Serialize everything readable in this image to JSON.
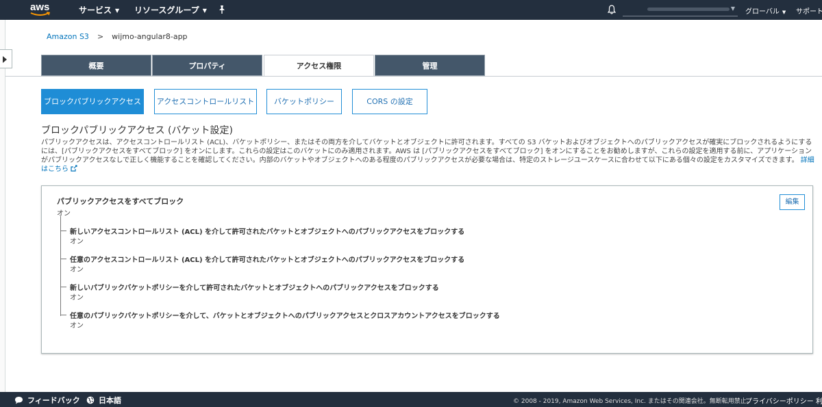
{
  "topnav": {
    "logo_text": "aws",
    "services_label": "サービス",
    "resource_groups_label": "リソースグループ",
    "region_label": "グローバル",
    "support_label": "サポート"
  },
  "breadcrumb": {
    "root": "Amazon S3",
    "separator": ">",
    "current": "wijmo-angular8-app"
  },
  "tabs": [
    "概要",
    "プロパティ",
    "アクセス権限",
    "管理"
  ],
  "subtabs": [
    "ブロックパブリックアクセス",
    "アクセスコントロールリスト",
    "バケットポリシー",
    "CORS の設定"
  ],
  "section": {
    "title": "ブロックパブリックアクセス (バケット設定)",
    "description": "パブリックアクセスは、アクセスコントロールリスト (ACL)、バケットポリシー、またはその両方を介してバケットとオブジェクトに許可されます。すべての S3 バケットおよびオブジェクトへのパブリックアクセスが確実にブロックされるようにするには、[パブリックアクセスをすべてブロック] をオンにします。これらの設定はこのバケットにのみ適用されます。AWS は [パブリックアクセスをすべてブロック] をオンにすることをお勧めしますが、これらの設定を適用する前に、アプリケーションがパブリックアクセスなしで正しく機能することを確認してください。内部のバケットやオブジェクトへのある程度のパブリックアクセスが必要な場合は、特定のストレージユースケースに合わせて以下にある個々の設定をカスタマイズできます。",
    "more_link": "詳細はこちら"
  },
  "settings": {
    "edit_label": "編集",
    "main": {
      "label": "パブリックアクセスをすべてブロック",
      "value": "オン"
    },
    "children": [
      {
        "label": "新しいアクセスコントロールリスト (ACL) を介して許可されたバケットとオブジェクトへのパブリックアクセスをブロックする",
        "value": "オン"
      },
      {
        "label": "任意のアクセスコントロールリスト (ACL) を介して許可されたバケットとオブジェクトへのパブリックアクセスをブロックする",
        "value": "オン"
      },
      {
        "label": "新しいパブリックバケットポリシーを介して許可されたバケットとオブジェクトへのパブリックアクセスをブロックする",
        "value": "オン"
      },
      {
        "label": "任意のパブリックバケットポリシーを介して、バケットとオブジェクトへのパブリックアクセスとクロスアカウントアクセスをブロックする",
        "value": "オン"
      }
    ]
  },
  "footer": {
    "feedback_label": "フィードバック",
    "language_label": "日本語",
    "copyright": "© 2008 - 2019, Amazon Web Services, Inc. またはその関連会社。無断転用禁止。",
    "privacy_label": "プライバシーポリシー",
    "terms_label": "利"
  },
  "colors": {
    "nav_bg": "#232f3e",
    "tab_bg": "#44576a",
    "accent": "#1f8dd6",
    "link": "#0073bb",
    "aws_orange": "#ff9900"
  },
  "icons": [
    "aws-logo",
    "pin-icon",
    "bell-icon",
    "expand-panel-icon",
    "external-link-icon",
    "feedback-icon",
    "globe-icon"
  ]
}
